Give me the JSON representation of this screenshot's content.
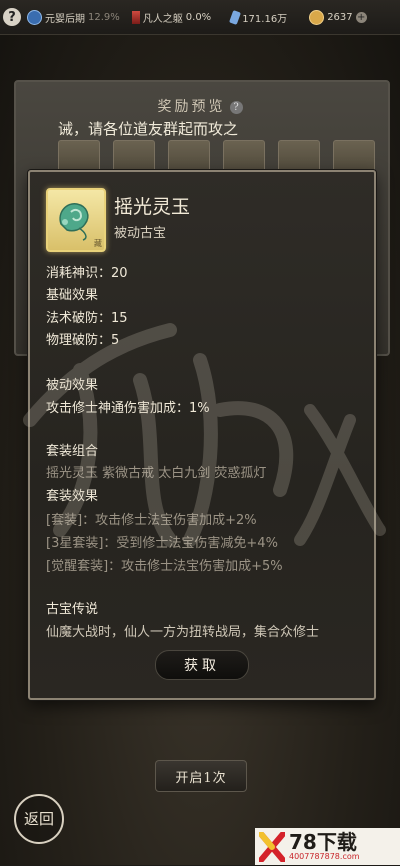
{
  "topbar": {
    "help": "?",
    "stats": [
      {
        "icon": "spirit-orb-icon",
        "label": "元婴后期",
        "extra": "12.9%",
        "color": "#4a8fd8"
      },
      {
        "icon": "red-sword-icon",
        "label": "凡人之躯",
        "extra": "0.0%",
        "color": "#c0403a"
      },
      {
        "icon": "blue-crystal-icon",
        "label": "171.16万",
        "extra": "",
        "color": "#7aa8e0"
      },
      {
        "icon": "gold-coin-icon",
        "label": "2637",
        "extra": "",
        "color": "#d9a84a"
      }
    ],
    "plus": "+"
  },
  "preview": {
    "title": "奖励预览",
    "help": "?",
    "marquee": "诫，请各位道友群起而攻之"
  },
  "item": {
    "name": "摇光灵玉",
    "type": "被动古宝",
    "tag": "藏",
    "consume": "消耗神识：20",
    "base_title": "基础效果",
    "base_effects": [
      "法术破防：15",
      "物理破防：5"
    ],
    "passive_title": "被动效果",
    "passive_effect": "攻击修士神通伤害加成：1%",
    "set_title": "套装组合",
    "set_members": "摇光灵玉 紫微古戒 太白九剑 荧惑孤灯",
    "set_effect_title": "套装效果",
    "set_effects": [
      "[套装]：攻击修士法宝伤害加成+2%",
      "[3星套装]：受到修士法宝伤害减免+4%",
      "[觉醒套装]：攻击修士法宝伤害加成+5%"
    ],
    "legend_title": "古宝传说",
    "legend_text": "仙魔大战时，仙人一方为扭转战局，集合众修士"
  },
  "buttons": {
    "obtain": "获取",
    "open": "开启1次",
    "back": "返回"
  },
  "logo": {
    "main": "78下载",
    "sub": "4007787878.com"
  }
}
